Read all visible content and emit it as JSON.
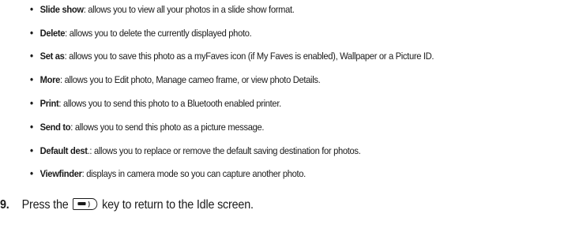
{
  "options": [
    {
      "term": "Slide show",
      "description": ": allows you to view all your photos in a slide show format."
    },
    {
      "term": "Delete",
      "description": ": allows you to delete the currently displayed photo."
    },
    {
      "term": "Set as",
      "description": ": allows you to save this photo as a myFaves icon (if My Faves is enabled), Wallpaper or a Picture ID."
    },
    {
      "term": "More",
      "description": ": allows you to Edit photo, Manage cameo frame, or view photo Details."
    },
    {
      "term": "Print",
      "description": ": allows you to send this photo to a Bluetooth enabled printer."
    },
    {
      "term": "Send to",
      "description": ": allows you to send this photo as a picture message."
    },
    {
      "term": "Default dest",
      "description": ".: allows you to replace or remove the default saving destination for photos."
    },
    {
      "term": "Viewfinder",
      "description": ": displays in camera mode so you can capture another photo."
    }
  ],
  "bullet_symbol": "•",
  "step": {
    "number": "9.",
    "text_before": "Press the",
    "key_icon": "end-power-key-icon",
    "text_after": "key to return to the Idle screen."
  }
}
